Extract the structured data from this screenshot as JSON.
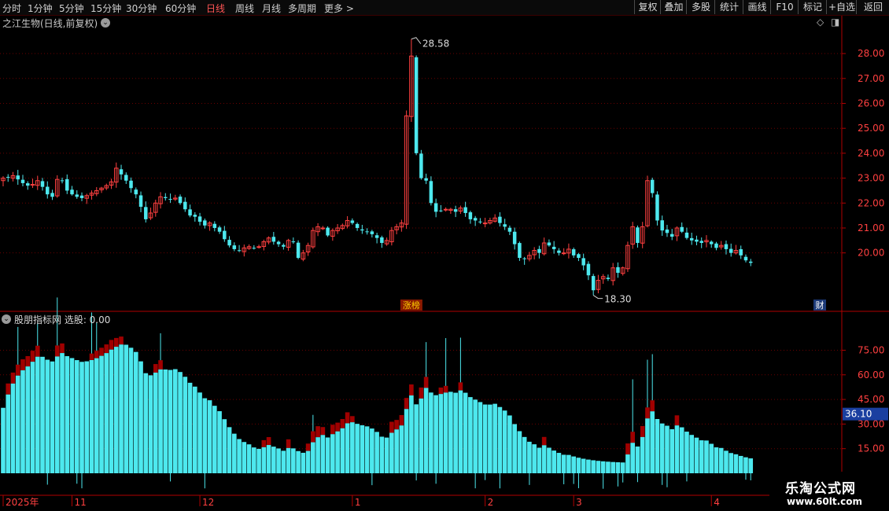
{
  "toolbar": {
    "periods": [
      "分时",
      "1分钟",
      "5分钟",
      "15分钟",
      "30分钟",
      "60分钟",
      "日线",
      "周线",
      "月线",
      "多周期",
      "更多 >"
    ],
    "active_period": "日线",
    "buttons": [
      "复权",
      "叠加",
      "多股",
      "统计",
      "画线",
      "F10",
      "标记",
      "+自选",
      "返回"
    ]
  },
  "main_panel": {
    "title": "之江生物(日线,前复权)",
    "zt_badge": "涨榜",
    "cai_badge": "财"
  },
  "indicator_panel": {
    "title": "股朋指标网 选股: 0.00"
  },
  "colors": {
    "up": "#ff4040",
    "down": "#4de8ee",
    "grid": "#6a0000",
    "axis": "#b00000",
    "band": "#a00000"
  },
  "watermark": {
    "line1": "乐淘公式网",
    "line2": "www.60lt.com"
  },
  "chart_data": [
    {
      "type": "candlestick",
      "title": "之江生物(日线,前复权)",
      "y_ticks": [
        20.0,
        21.0,
        22.0,
        23.0,
        24.0,
        25.0,
        26.0,
        27.0,
        28.0
      ],
      "y_tick_labels": [
        "20.00",
        "21.00",
        "22.00",
        "23.00",
        "24.00",
        "25.00",
        "26.00",
        "27.00",
        "28.00"
      ],
      "ylim": [
        17.75,
        28.95
      ],
      "annotations": [
        {
          "text": "28.58",
          "value": 28.58
        },
        {
          "text": "18.30",
          "value": 18.3
        }
      ],
      "closes": [
        23.0,
        23.05,
        23.1,
        22.95,
        22.8,
        22.7,
        22.75,
        22.9,
        22.65,
        22.35,
        22.25,
        22.95,
        22.9,
        22.5,
        22.35,
        22.25,
        22.2,
        22.3,
        22.4,
        22.5,
        22.6,
        22.7,
        22.85,
        23.4,
        23.15,
        22.9,
        22.6,
        22.35,
        21.85,
        21.35,
        21.6,
        22.0,
        22.25,
        22.2,
        22.15,
        22.2,
        22.0,
        21.75,
        21.5,
        21.45,
        21.25,
        21.1,
        21.2,
        21.0,
        20.85,
        20.55,
        20.3,
        20.15,
        20.1,
        20.2,
        20.25,
        20.2,
        20.25,
        20.45,
        20.6,
        20.45,
        20.35,
        20.25,
        20.5,
        20.45,
        19.8,
        20.0,
        20.3,
        20.9,
        21.05,
        21.0,
        20.7,
        20.9,
        21.0,
        21.1,
        21.3,
        21.2,
        21.0,
        20.9,
        20.85,
        20.75,
        20.6,
        20.4,
        20.5,
        20.9,
        21.05,
        21.2,
        25.5,
        27.9,
        24.0,
        23.0,
        22.9,
        22.0,
        21.65,
        21.7,
        21.75,
        21.75,
        21.65,
        21.8,
        21.6,
        21.35,
        21.3,
        21.25,
        21.2,
        21.3,
        21.4,
        21.2,
        21.05,
        20.85,
        20.35,
        19.8,
        19.75,
        19.9,
        20.1,
        20.0,
        20.4,
        20.3,
        20.15,
        20.0,
        20.0,
        20.15,
        19.9,
        19.8,
        19.5,
        19.1,
        18.5,
        18.9,
        19.05,
        18.95,
        19.4,
        19.2,
        19.4,
        20.3,
        21.05,
        20.4,
        21.05,
        22.9,
        22.4,
        21.3,
        20.9,
        20.8,
        20.65,
        21.0,
        20.85,
        20.6,
        20.5,
        20.45,
        20.4,
        20.5,
        20.35,
        20.2,
        20.3,
        20.15,
        20.0,
        20.1,
        19.9,
        19.7,
        19.6
      ],
      "n_bars": 168,
      "x_axis_labels": [
        {
          "text": "2025年",
          "bar": 0
        },
        {
          "text": "11",
          "bar": 14
        },
        {
          "text": "12",
          "bar": 40
        },
        {
          "text": "1",
          "bar": 71
        },
        {
          "text": "2",
          "bar": 98
        },
        {
          "text": "3",
          "bar": 116
        },
        {
          "text": "4",
          "bar": 144
        }
      ]
    },
    {
      "type": "bar",
      "title": "股朋指标网 选股: 0.00",
      "y_ticks": [
        15.0,
        30.0,
        45.0,
        60.0,
        75.0
      ],
      "y_tick_labels": [
        "15.00",
        "30.00",
        "45.00",
        "60.00",
        "75.00"
      ],
      "ylim": [
        0,
        92
      ],
      "current_value_label": "36.10",
      "current_value": 36.1,
      "n_bars": 168
    }
  ]
}
